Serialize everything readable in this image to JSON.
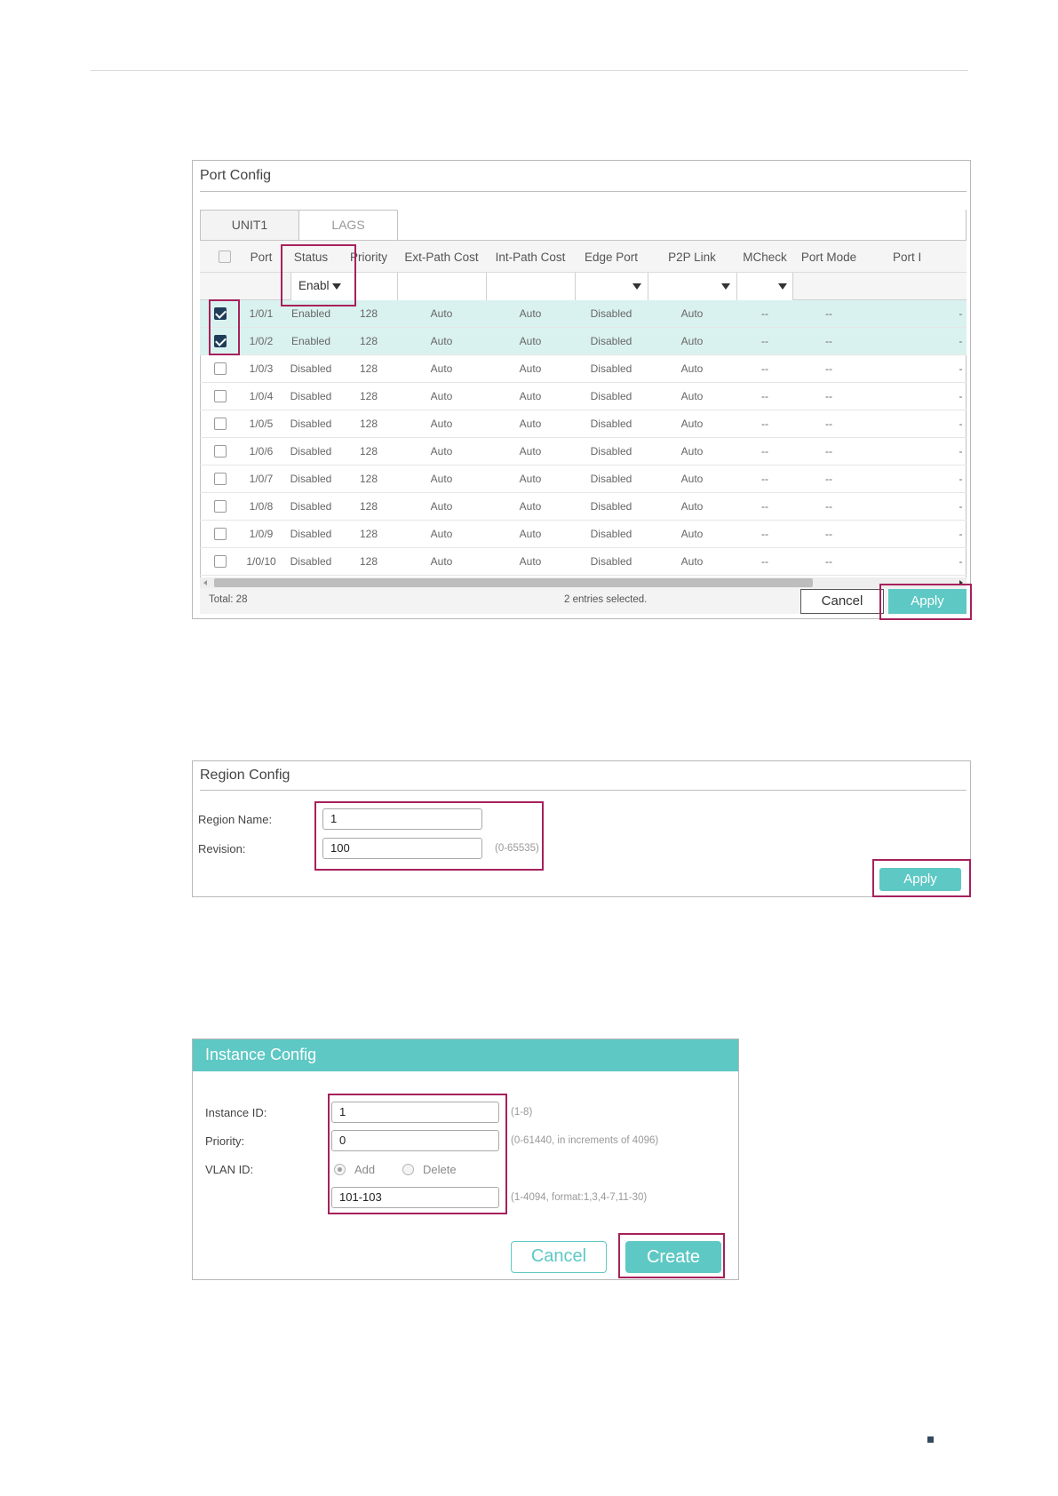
{
  "port_config": {
    "title": "Port Config",
    "tabs": [
      "UNIT1",
      "LAGS"
    ],
    "columns": [
      "Port",
      "Status",
      "Priority",
      "Ext-Path Cost",
      "Int-Path Cost",
      "Edge Port",
      "P2P Link",
      "MCheck",
      "Port Mode",
      "Port I"
    ],
    "status_filter": "Enabl",
    "rows": [
      {
        "checked": true,
        "port": "1/0/1",
        "status": "Enabled",
        "priority": "128",
        "ext": "Auto",
        "int": "Auto",
        "edge": "Disabled",
        "p2p": "Auto",
        "mcheck": "--",
        "mode": "--",
        "more": "-"
      },
      {
        "checked": true,
        "port": "1/0/2",
        "status": "Enabled",
        "priority": "128",
        "ext": "Auto",
        "int": "Auto",
        "edge": "Disabled",
        "p2p": "Auto",
        "mcheck": "--",
        "mode": "--",
        "more": "-"
      },
      {
        "checked": false,
        "port": "1/0/3",
        "status": "Disabled",
        "priority": "128",
        "ext": "Auto",
        "int": "Auto",
        "edge": "Disabled",
        "p2p": "Auto",
        "mcheck": "--",
        "mode": "--",
        "more": "-"
      },
      {
        "checked": false,
        "port": "1/0/4",
        "status": "Disabled",
        "priority": "128",
        "ext": "Auto",
        "int": "Auto",
        "edge": "Disabled",
        "p2p": "Auto",
        "mcheck": "--",
        "mode": "--",
        "more": "-"
      },
      {
        "checked": false,
        "port": "1/0/5",
        "status": "Disabled",
        "priority": "128",
        "ext": "Auto",
        "int": "Auto",
        "edge": "Disabled",
        "p2p": "Auto",
        "mcheck": "--",
        "mode": "--",
        "more": "-"
      },
      {
        "checked": false,
        "port": "1/0/6",
        "status": "Disabled",
        "priority": "128",
        "ext": "Auto",
        "int": "Auto",
        "edge": "Disabled",
        "p2p": "Auto",
        "mcheck": "--",
        "mode": "--",
        "more": "-"
      },
      {
        "checked": false,
        "port": "1/0/7",
        "status": "Disabled",
        "priority": "128",
        "ext": "Auto",
        "int": "Auto",
        "edge": "Disabled",
        "p2p": "Auto",
        "mcheck": "--",
        "mode": "--",
        "more": "-"
      },
      {
        "checked": false,
        "port": "1/0/8",
        "status": "Disabled",
        "priority": "128",
        "ext": "Auto",
        "int": "Auto",
        "edge": "Disabled",
        "p2p": "Auto",
        "mcheck": "--",
        "mode": "--",
        "more": "-"
      },
      {
        "checked": false,
        "port": "1/0/9",
        "status": "Disabled",
        "priority": "128",
        "ext": "Auto",
        "int": "Auto",
        "edge": "Disabled",
        "p2p": "Auto",
        "mcheck": "--",
        "mode": "--",
        "more": "-"
      },
      {
        "checked": false,
        "port": "1/0/10",
        "status": "Disabled",
        "priority": "128",
        "ext": "Auto",
        "int": "Auto",
        "edge": "Disabled",
        "p2p": "Auto",
        "mcheck": "--",
        "mode": "--",
        "more": "-"
      }
    ],
    "total": "Total: 28",
    "selected_info": "2 entries selected.",
    "cancel_label": "Cancel",
    "apply_label": "Apply"
  },
  "region_config": {
    "title": "Region Config",
    "name_label": "Region Name:",
    "name_value": "1",
    "revision_label": "Revision:",
    "revision_value": "100",
    "revision_hint": "(0-65535)",
    "apply_label": "Apply"
  },
  "instance_config": {
    "title": "Instance Config",
    "id_label": "Instance ID:",
    "id_value": "1",
    "id_hint": "(1-8)",
    "priority_label": "Priority:",
    "priority_value": "0",
    "priority_hint": "(0-61440, in increments of 4096)",
    "vlan_label": "VLAN ID:",
    "radio_add": "Add",
    "radio_delete": "Delete",
    "vlan_value": "101-103",
    "vlan_hint": "(1-4094, format:1,3,4-7,11-30)",
    "cancel_label": "Cancel",
    "create_label": "Create"
  },
  "colors": {
    "accent": "#5ec8c4",
    "highlight": "#a6215b",
    "selected_row": "#daf2ef",
    "checkbox": "#1f3d5a"
  }
}
